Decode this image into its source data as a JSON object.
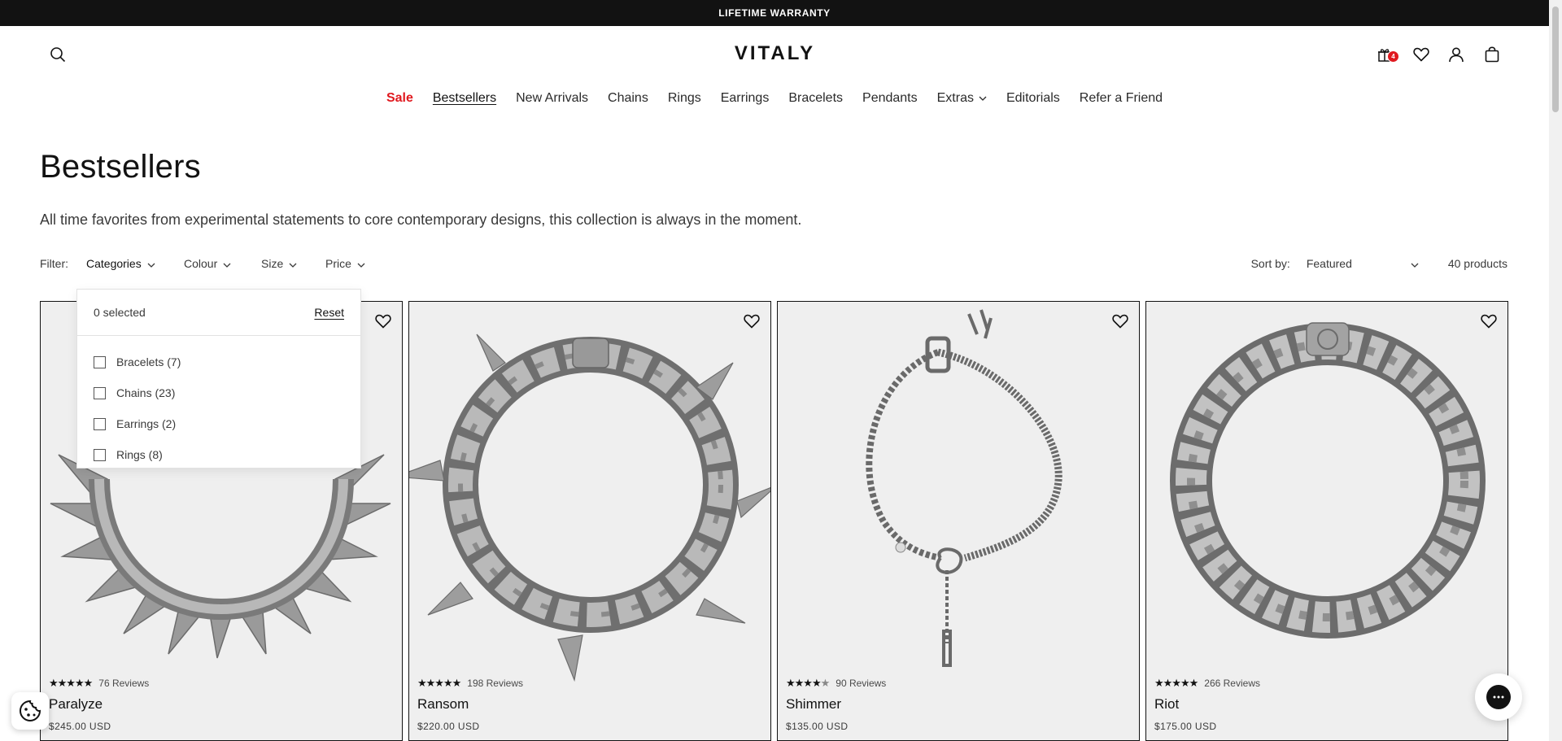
{
  "announcement": "LIFETIME WARRANTY",
  "brand": "VITALY",
  "header": {
    "icons": [
      "search-icon",
      "gift-icon",
      "heart-icon",
      "account-icon",
      "cart-icon"
    ],
    "gift_badge": "4"
  },
  "nav": {
    "items": [
      {
        "label": "Sale"
      },
      {
        "label": "Bestsellers"
      },
      {
        "label": "New Arrivals"
      },
      {
        "label": "Chains"
      },
      {
        "label": "Rings"
      },
      {
        "label": "Earrings"
      },
      {
        "label": "Bracelets"
      },
      {
        "label": "Pendants"
      },
      {
        "label": "Extras"
      },
      {
        "label": "Editorials"
      },
      {
        "label": "Refer a Friend"
      }
    ],
    "active": "Bestsellers",
    "sale_color": "#e0191f"
  },
  "collection": {
    "title": "Bestsellers",
    "description": "All time favorites from experimental statements to core contemporary designs, this collection is always in the moment."
  },
  "filters": {
    "label": "Filter:",
    "buttons": [
      "Categories",
      "Colour",
      "Size",
      "Price"
    ],
    "sort_label": "Sort by:",
    "sort_value": "Featured",
    "product_count": "40 products"
  },
  "categories_dropdown": {
    "selected_text": "0 selected",
    "reset_label": "Reset",
    "options": [
      "Bracelets (7)",
      "Chains (23)",
      "Earrings (2)",
      "Rings (8)"
    ]
  },
  "products": [
    {
      "name": "Paralyze",
      "price": "$245.00 USD",
      "reviews": "76 Reviews",
      "rating": 5
    },
    {
      "name": "Ransom",
      "price": "$220.00 USD",
      "reviews": "198 Reviews",
      "rating": 5
    },
    {
      "name": "Shimmer",
      "price": "$135.00 USD",
      "reviews": "90 Reviews",
      "rating": 4.5
    },
    {
      "name": "Riot",
      "price": "$175.00 USD",
      "reviews": "266 Reviews",
      "rating": 5
    }
  ]
}
